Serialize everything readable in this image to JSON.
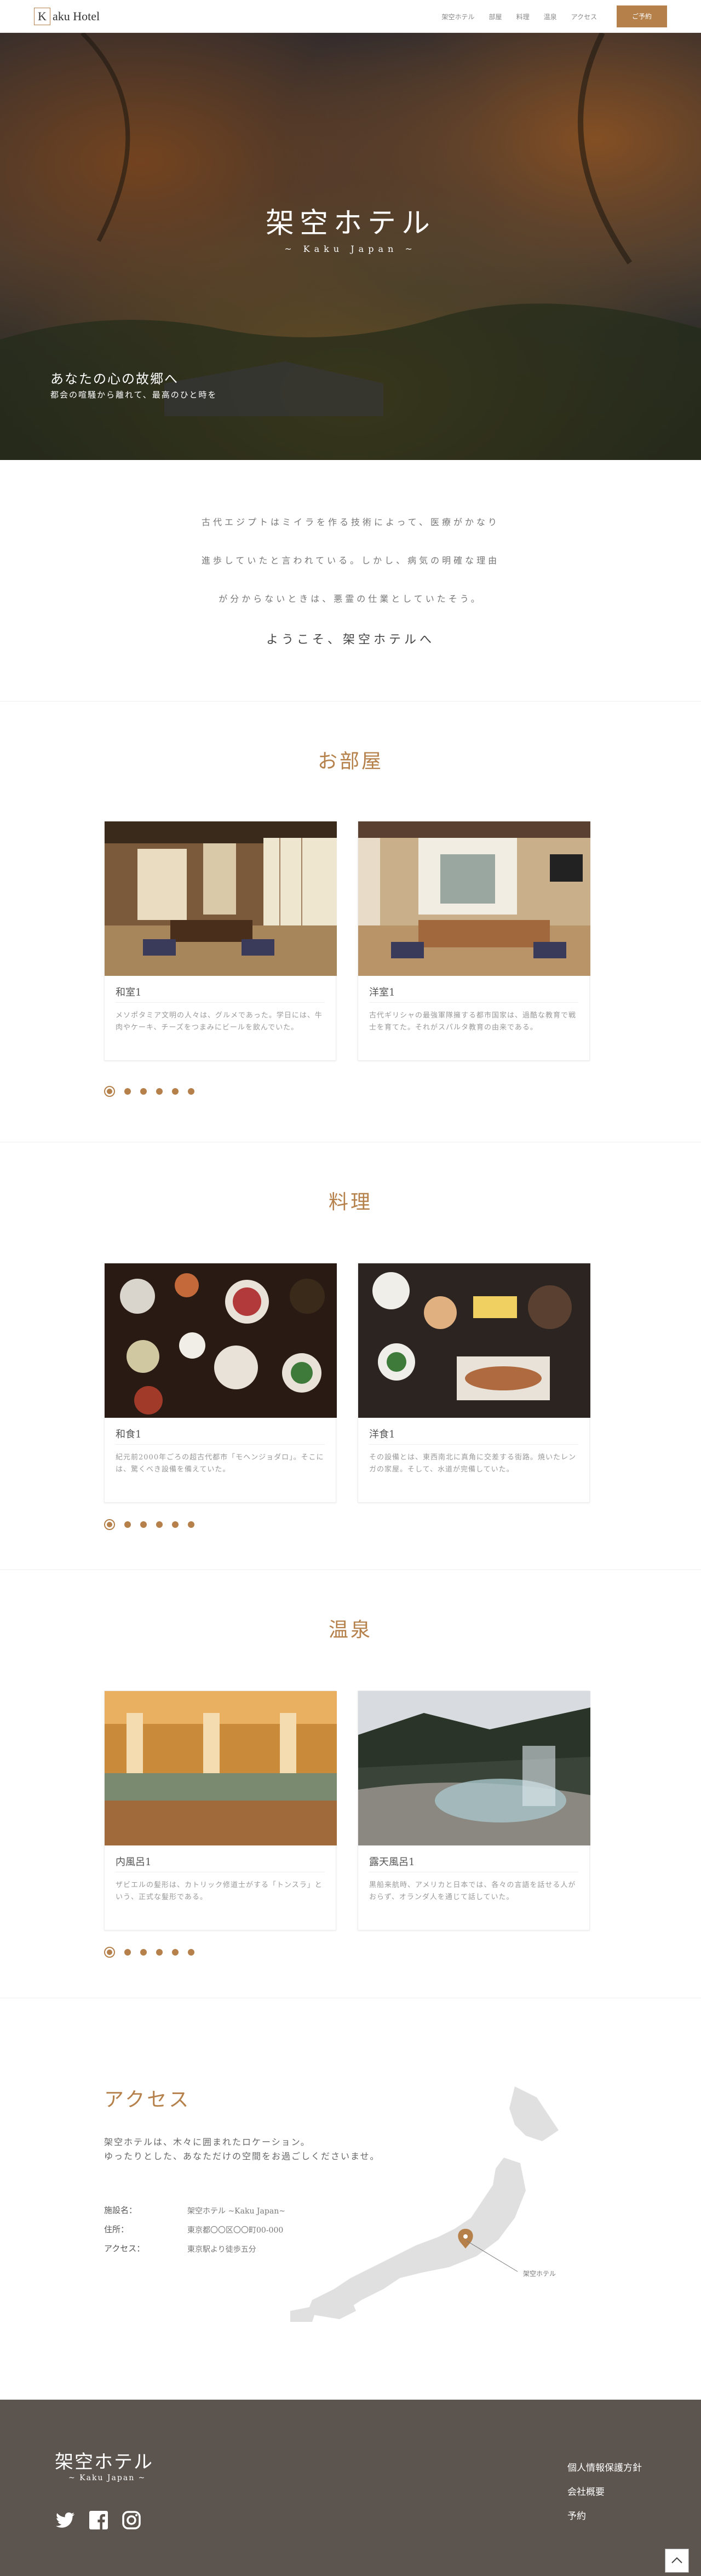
{
  "header": {
    "logo_initial": "K",
    "logo_text": "aku Hotel",
    "nav": [
      "架空ホテル",
      "部屋",
      "料理",
      "温泉",
      "アクセス"
    ],
    "reserve_label": "ご予約"
  },
  "hero": {
    "title": "架空ホテル",
    "subtitle": "~ Kaku Japan ~",
    "tagline1": "あなたの心の故郷へ",
    "tagline2": "都会の喧騒から離れて、最高のひと時を"
  },
  "intro": {
    "lines": [
      "古代エジプトはミイラを作る技術によって、医療がかなり",
      "進歩していたと言われている。しかし、病気の明確な理由",
      "が分からないときは、悪霊の仕業としていたそう。"
    ],
    "welcome": "ようこそ、架空ホテルへ"
  },
  "rooms": {
    "title": "お部屋",
    "cards": [
      {
        "name": "和室1",
        "desc": "メソポタミア文明の人々は、グルメであった。学日には、牛肉やケーキ、チーズをつまみにビールを飲んでいた。"
      },
      {
        "name": "洋室1",
        "desc": "古代ギリシャの最強軍隊擁する都市国家は、過酷な教育で戦士を育てた。それがスパルタ教育の由来である。"
      }
    ]
  },
  "cuisine": {
    "title": "料理",
    "cards": [
      {
        "name": "和食1",
        "desc": "紀元前2000年ごろの超古代都市「モヘンジョダロ」。そこには、驚くべき設備を備えていた。"
      },
      {
        "name": "洋食1",
        "desc": "その設備とは、東西南北に真角に交差する街路。焼いたレンガの家屋。そして、水道が完備していた。"
      }
    ]
  },
  "onsen": {
    "title": "温泉",
    "cards": [
      {
        "name": "内風呂1",
        "desc": "ザビエルの髪形は、カトリック修道士がする「トンスラ」という、正式な髪形である。"
      },
      {
        "name": "露天風呂1",
        "desc": "黒船来航時、アメリカと日本では、各々の言語を話せる人がおらず、オランダ人を通じて話していた。"
      }
    ]
  },
  "access": {
    "title": "アクセス",
    "text1": "架空ホテルは、木々に囲まれたロケーション。",
    "text2": "ゆったりとした、あなただけの空間をお過ごしくださいませ。",
    "facility_label": "施設名：",
    "facility_value": "架空ホテル ~Kaku Japan~",
    "address_label": "住所：",
    "address_value": "東京都〇〇区〇〇町00-000",
    "route_label": "アクセス：",
    "route_value": "東京駅より徒歩五分",
    "map_label": "架空ホテル"
  },
  "footer": {
    "title": "架空ホテル",
    "subtitle": "~ Kaku Japan ~",
    "links": [
      "個人情報保護方針",
      "会社概要",
      "予約"
    ]
  },
  "colors": {
    "accent": "#b5804a",
    "footer_bg": "#5c544e"
  },
  "icons": [
    "twitter-icon",
    "facebook-icon",
    "instagram-icon",
    "chevron-up-icon"
  ]
}
